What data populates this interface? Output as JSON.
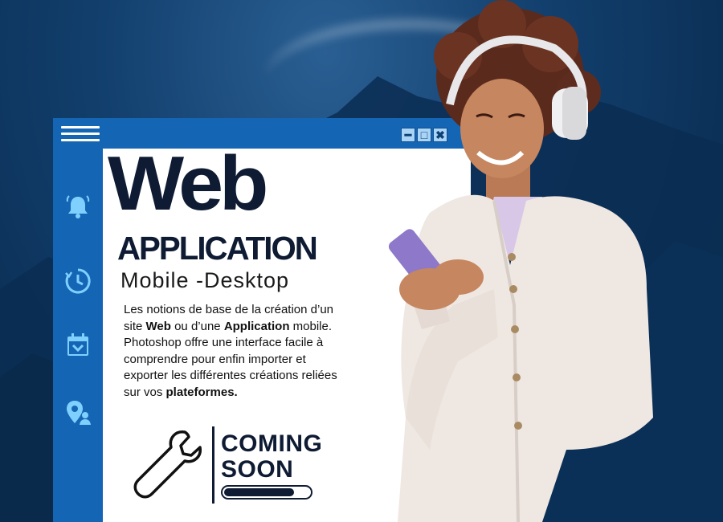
{
  "window": {
    "controls": {
      "minimize": "━",
      "maximize": "□",
      "close": "✖"
    }
  },
  "sidebar": {
    "icons": [
      "bell-icon",
      "clock-icon",
      "calendar-icon",
      "map-pin-person-icon"
    ]
  },
  "content": {
    "title": "Web",
    "subtitle_main": "APPLICATION",
    "subtitle_secondary": "Mobile -Desktop",
    "description": {
      "line1_a": "Les notions de base de la création d’un",
      "line2_a": "site ",
      "line2_b": "Web",
      "line2_c": " ou d’une ",
      "line2_d": "Application",
      "line2_e": " mobile.",
      "line3": "Photoshop offre une interface facile à",
      "line4": "comprendre pour enfin importer et",
      "line5": "exporter les différentes créations reliées",
      "line6_a": "sur vos ",
      "line6_b": "plateformes."
    },
    "coming_soon": {
      "line1": "COMING",
      "line2": "SOON",
      "progress_percent": 82
    }
  },
  "colors": {
    "window_blue": "#1565b5",
    "title_navy": "#0e1b33",
    "background": "#0d3a66"
  }
}
